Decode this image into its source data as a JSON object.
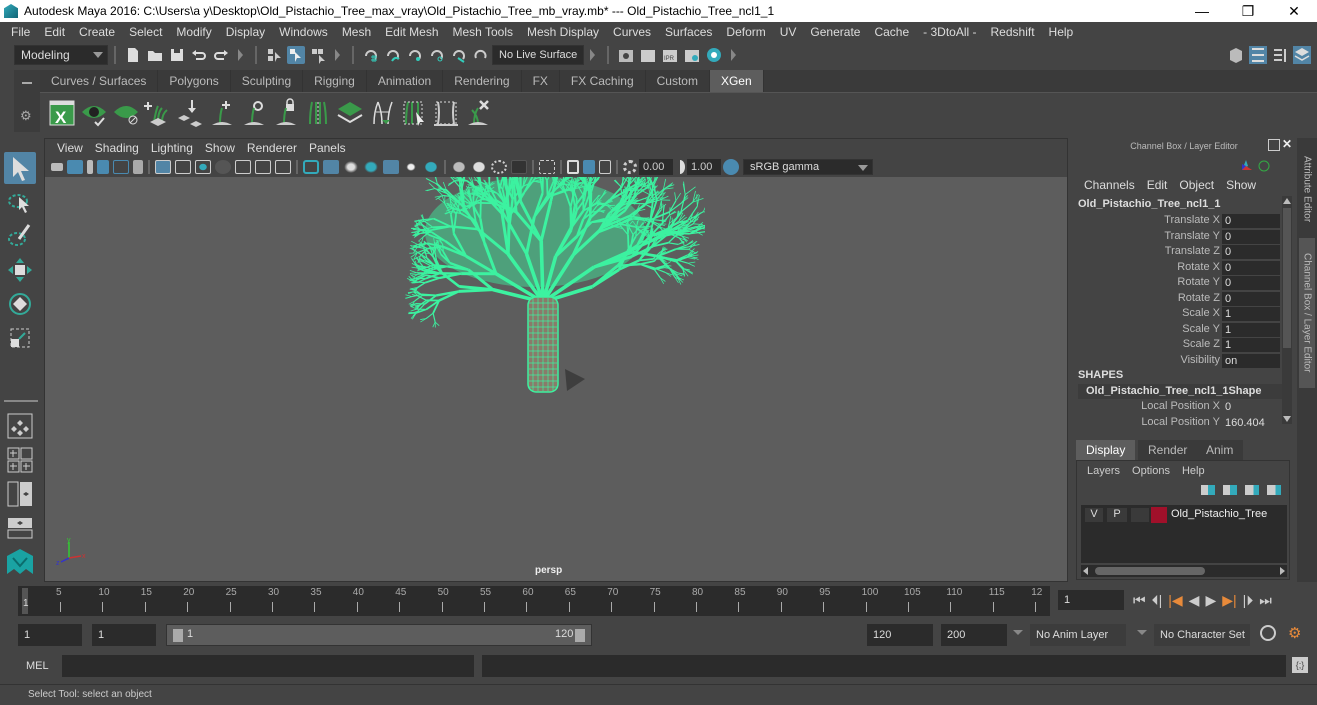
{
  "window": {
    "title": "Autodesk Maya 2016: C:\\Users\\a y\\Desktop\\Old_Pistachio_Tree_max_vray\\Old_Pistachio_Tree_mb_vray.mb*   ---   Old_Pistachio_Tree_ncl1_1",
    "minimize": "—",
    "restore": "❐",
    "close": "✕"
  },
  "menubar": [
    "File",
    "Edit",
    "Create",
    "Select",
    "Modify",
    "Display",
    "Windows",
    "Mesh",
    "Edit Mesh",
    "Mesh Tools",
    "Mesh Display",
    "Curves",
    "Surfaces",
    "Deform",
    "UV",
    "Generate",
    "Cache",
    "- 3DtoAll -",
    "Redshift",
    "Help"
  ],
  "statusline": {
    "mode": "Modeling",
    "live_surface": "No Live Surface"
  },
  "shelf": {
    "tabs": [
      "Curves / Surfaces",
      "Polygons",
      "Sculpting",
      "Rigging",
      "Animation",
      "Rendering",
      "FX",
      "FX Caching",
      "Custom",
      "XGen"
    ],
    "active_tab": "XGen",
    "icons": [
      "xgen-editor-icon",
      "xgen-preview-icon",
      "xgen-clear-preview-icon",
      "add-guides-icon",
      "sculpt-guides-icon",
      "add-guide-icon",
      "select-guide-icon",
      "lock-guide-icon",
      "rebuild-guides-icon",
      "convert-to-poly-icon",
      "guides-to-curves-icon",
      "curves-to-guides-icon",
      "toggle-guides-icon",
      "delete-guides-icon"
    ]
  },
  "viewport": {
    "menu": [
      "View",
      "Shading",
      "Lighting",
      "Show",
      "Renderer",
      "Panels"
    ],
    "exposure": "0.00",
    "gamma": "1.00",
    "color_space": "sRGB gamma",
    "camera_label": "persp",
    "axis": {
      "y": "y",
      "z": "z",
      "x": "x"
    },
    "wireframe_color": "#3cf2a0"
  },
  "channel_box": {
    "title": "Channel Box / Layer Editor",
    "menu": [
      "Channels",
      "Edit",
      "Object",
      "Show"
    ],
    "object_name": "Old_Pistachio_Tree_ncl1_1",
    "channels": [
      {
        "label": "Translate X",
        "value": "0"
      },
      {
        "label": "Translate Y",
        "value": "0"
      },
      {
        "label": "Translate Z",
        "value": "0"
      },
      {
        "label": "Rotate X",
        "value": "0"
      },
      {
        "label": "Rotate Y",
        "value": "0"
      },
      {
        "label": "Rotate Z",
        "value": "0"
      },
      {
        "label": "Scale X",
        "value": "1"
      },
      {
        "label": "Scale Y",
        "value": "1"
      },
      {
        "label": "Scale Z",
        "value": "1"
      },
      {
        "label": "Visibility",
        "value": "on"
      }
    ],
    "shapes_header": "SHAPES",
    "shape_name": "Old_Pistachio_Tree_ncl1_1Shape",
    "shape_channels": [
      {
        "label": "Local Position X",
        "value": "0"
      },
      {
        "label": "Local Position Y",
        "value": "160.404"
      }
    ]
  },
  "side_tabs": [
    "Attribute Editor",
    "Channel Box / Layer Editor"
  ],
  "layer_editor": {
    "tabs": [
      "Display",
      "Render",
      "Anim"
    ],
    "active_tab": "Display",
    "menu": [
      "Layers",
      "Options",
      "Help"
    ],
    "layers": [
      {
        "visible": "V",
        "playback": "P",
        "name": "Old_Pistachio_Tree",
        "color": "#a0102a"
      }
    ]
  },
  "timeline": {
    "ticks": [
      "5",
      "10",
      "15",
      "20",
      "25",
      "30",
      "35",
      "40",
      "45",
      "50",
      "55",
      "60",
      "65",
      "70",
      "75",
      "80",
      "85",
      "90",
      "95",
      "100",
      "105",
      "110",
      "115",
      "12"
    ],
    "current_marker": "1",
    "current_frame": "1"
  },
  "range": {
    "start": "1",
    "playback_start": "1",
    "slider_start": "1",
    "slider_end": "120",
    "playback_end": "120",
    "end": "200",
    "anim_layer": "No Anim Layer",
    "character_set": "No Character Set"
  },
  "command_line": {
    "label": "MEL",
    "value": ""
  },
  "help_line": "Select Tool: select an object"
}
